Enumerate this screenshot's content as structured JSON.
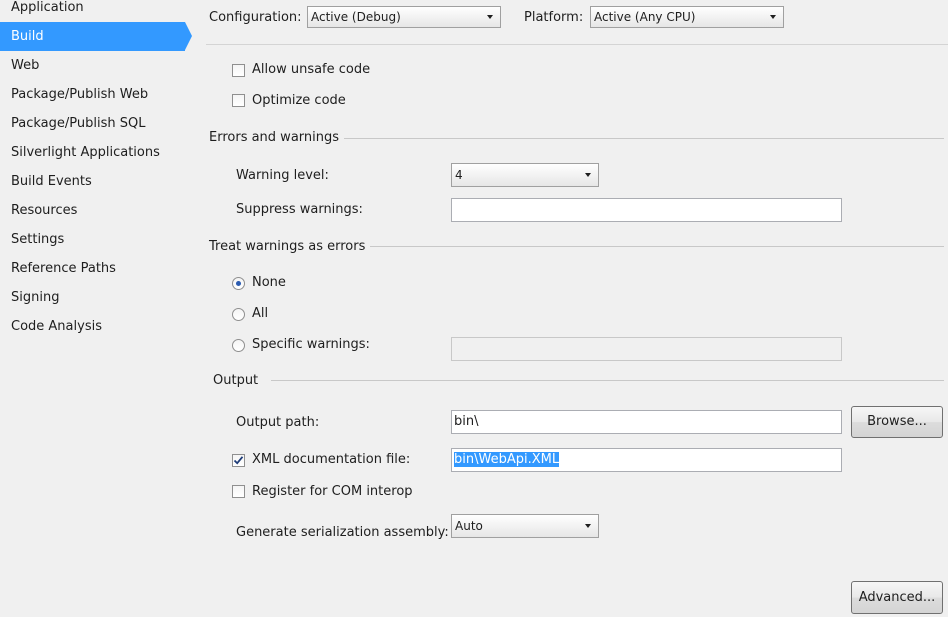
{
  "sidebar": {
    "items": [
      {
        "label": "Application"
      },
      {
        "label": "Build",
        "selected": true
      },
      {
        "label": "Web"
      },
      {
        "label": "Package/Publish Web"
      },
      {
        "label": "Package/Publish SQL"
      },
      {
        "label": "Silverlight Applications"
      },
      {
        "label": "Build Events"
      },
      {
        "label": "Resources"
      },
      {
        "label": "Settings"
      },
      {
        "label": "Reference Paths"
      },
      {
        "label": "Signing"
      },
      {
        "label": "Code Analysis"
      }
    ]
  },
  "header": {
    "configuration_label": "Configuration:",
    "configuration_value": "Active (Debug)",
    "platform_label": "Platform:",
    "platform_value": "Active (Any CPU)"
  },
  "general": {
    "allow_unsafe_label": "Allow unsafe code",
    "allow_unsafe_checked": false,
    "optimize_label": "Optimize code",
    "optimize_checked": false
  },
  "errors_warnings": {
    "group_title": "Errors and warnings",
    "warning_level_label": "Warning level:",
    "warning_level_value": "4",
    "suppress_label": "Suppress warnings:",
    "suppress_value": ""
  },
  "treat_warnings": {
    "group_title": "Treat warnings as errors",
    "options": [
      {
        "label": "None",
        "selected": true
      },
      {
        "label": "All",
        "selected": false
      },
      {
        "label": "Specific warnings:",
        "selected": false
      }
    ],
    "specific_value": ""
  },
  "output": {
    "group_title": "Output",
    "output_path_label": "Output path:",
    "output_path_value": "bin\\",
    "browse_label": "Browse...",
    "xml_doc_label": "XML documentation file:",
    "xml_doc_checked": true,
    "xml_doc_value": "bin\\WebApi.XML",
    "com_interop_label": "Register for COM interop",
    "com_interop_checked": false,
    "serialization_label": "Generate serialization assembly:",
    "serialization_value": "Auto"
  },
  "footer": {
    "advanced_label": "Advanced..."
  },
  "colors": {
    "selection": "#3399ff",
    "background": "#f0f0f0",
    "radio_dot": "#2b5bb0",
    "checkmark": "#1e3c78"
  },
  "icons": {
    "checkmark": "check-icon",
    "dropdown": "chevron-down-icon"
  }
}
